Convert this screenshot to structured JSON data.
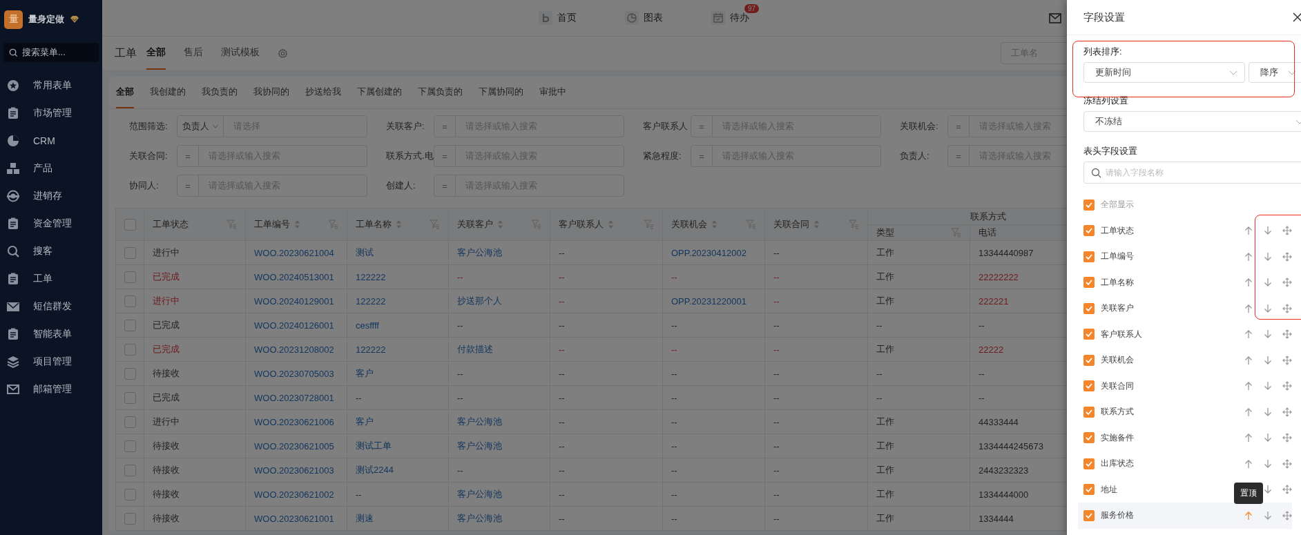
{
  "sidebar": {
    "logo": "量",
    "brand": "量身定做",
    "search_placeholder": "搜索菜单...",
    "items": [
      {
        "label": "常用表单"
      },
      {
        "label": "市场管理"
      },
      {
        "label": "CRM"
      },
      {
        "label": "产品"
      },
      {
        "label": "进销存"
      },
      {
        "label": "资金管理"
      },
      {
        "label": "搜客"
      },
      {
        "label": "工单"
      },
      {
        "label": "短信群发"
      },
      {
        "label": "智能表单"
      },
      {
        "label": "项目管理"
      },
      {
        "label": "邮箱管理"
      }
    ]
  },
  "top_nav": {
    "items": [
      {
        "label": "首页"
      },
      {
        "label": "图表"
      },
      {
        "label": "待办",
        "badge": "97"
      }
    ]
  },
  "module_tabs": {
    "title": "工单",
    "search_placeholder": "工单名",
    "tabs": [
      {
        "label": "全部",
        "selected": true
      },
      {
        "label": "售后",
        "selected": false
      },
      {
        "label": "测试模板",
        "selected": false
      }
    ]
  },
  "view_tabs": [
    {
      "label": "全部",
      "selected": true
    },
    {
      "label": "我创建的",
      "selected": false
    },
    {
      "label": "我负责的",
      "selected": false
    },
    {
      "label": "我协同的",
      "selected": false
    },
    {
      "label": "抄送给我",
      "selected": false
    },
    {
      "label": "下属创建的",
      "selected": false
    },
    {
      "label": "下属负责的",
      "selected": false
    },
    {
      "label": "下属协同的",
      "selected": false
    },
    {
      "label": "审批中",
      "selected": false
    }
  ],
  "filters": [
    {
      "label": "范围筛选:",
      "kind": "dropdown",
      "operator": "负责人",
      "placeholder": "请选择"
    },
    {
      "label": "关联客户:",
      "kind": "equals",
      "operator": "=",
      "placeholder": "请选择或输入搜索"
    },
    {
      "label": "客户联系人",
      "kind": "equals",
      "operator": "=",
      "placeholder": "请选择或输入搜索"
    },
    {
      "label": "关联机会:",
      "kind": "equals",
      "operator": "=",
      "placeholder": "请选择或输入搜索"
    },
    {
      "label": "关联合同:",
      "kind": "equals",
      "operator": "=",
      "placeholder": "请选择或输入搜索"
    },
    {
      "label": "联系方式.电",
      "kind": "equals",
      "operator": "=",
      "placeholder": "请选择或输入搜索"
    },
    {
      "label": "紧急程度:",
      "kind": "equals",
      "operator": "=",
      "placeholder": "请选择或输入搜索"
    },
    {
      "label": "负责人:",
      "kind": "equals",
      "operator": "=",
      "placeholder": "请选择或输入搜索"
    },
    {
      "label": "协同人:",
      "kind": "equals",
      "operator": "=",
      "placeholder": "请选择或输入搜索"
    },
    {
      "label": "创建人:",
      "kind": "equals",
      "operator": "=",
      "placeholder": "请选择或输入搜索"
    }
  ],
  "table": {
    "all_checked": false,
    "header_group": "联系方式",
    "columns": [
      {
        "label": "工单状态",
        "sortable": false,
        "filterable": true,
        "grouped": false
      },
      {
        "label": "工单编号",
        "sortable": true,
        "filterable": true,
        "grouped": false
      },
      {
        "label": "工单名称",
        "sortable": true,
        "filterable": true,
        "grouped": false
      },
      {
        "label": "关联客户",
        "sortable": true,
        "filterable": true,
        "grouped": false
      },
      {
        "label": "客户联系人",
        "sortable": true,
        "filterable": true,
        "grouped": false
      },
      {
        "label": "关联机会",
        "sortable": true,
        "filterable": true,
        "grouped": false
      },
      {
        "label": "关联合同",
        "sortable": true,
        "filterable": true,
        "grouped": false
      },
      {
        "label": "类型",
        "sortable": false,
        "filterable": true,
        "grouped": true
      },
      {
        "label": "电话",
        "sortable": false,
        "filterable": false,
        "grouped": true
      }
    ],
    "rows": [
      {
        "checked": false,
        "cells": [
          {
            "text": "进行中",
            "kind": "text"
          },
          {
            "text": "WOO.20230621004",
            "kind": "link"
          },
          {
            "text": "测试",
            "kind": "link"
          },
          {
            "text": "客户公海池",
            "kind": "link"
          },
          {
            "text": "--",
            "kind": "text"
          },
          {
            "text": "OPP.20230412002",
            "kind": "link"
          },
          {
            "text": "--",
            "kind": "text"
          },
          {
            "text": "工作",
            "kind": "text"
          },
          {
            "text": "13344440987",
            "kind": "text"
          }
        ]
      },
      {
        "checked": false,
        "cells": [
          {
            "text": "已完成",
            "kind": "alert"
          },
          {
            "text": "WOO.20240513001",
            "kind": "link"
          },
          {
            "text": "122222",
            "kind": "link"
          },
          {
            "text": "--",
            "kind": "alert"
          },
          {
            "text": "--",
            "kind": "alert"
          },
          {
            "text": "--",
            "kind": "alert"
          },
          {
            "text": "--",
            "kind": "alert"
          },
          {
            "text": "工作",
            "kind": "text"
          },
          {
            "text": "22222222",
            "kind": "alert"
          }
        ]
      },
      {
        "checked": false,
        "cells": [
          {
            "text": "进行中",
            "kind": "alert"
          },
          {
            "text": "WOO.20240129001",
            "kind": "link"
          },
          {
            "text": "122222",
            "kind": "link"
          },
          {
            "text": "抄送那个人",
            "kind": "link"
          },
          {
            "text": "--",
            "kind": "alert"
          },
          {
            "text": "OPP.20231220001",
            "kind": "link"
          },
          {
            "text": "--",
            "kind": "alert"
          },
          {
            "text": "工作",
            "kind": "text"
          },
          {
            "text": "222221",
            "kind": "alert"
          }
        ]
      },
      {
        "checked": false,
        "cells": [
          {
            "text": "已完成",
            "kind": "text"
          },
          {
            "text": "WOO.20240126001",
            "kind": "link"
          },
          {
            "text": "cesffff",
            "kind": "link"
          },
          {
            "text": "--",
            "kind": "text"
          },
          {
            "text": "--",
            "kind": "text"
          },
          {
            "text": "--",
            "kind": "text"
          },
          {
            "text": "--",
            "kind": "text"
          },
          {
            "text": "--",
            "kind": "text"
          },
          {
            "text": "--",
            "kind": "text"
          }
        ]
      },
      {
        "checked": false,
        "cells": [
          {
            "text": "已完成",
            "kind": "alert"
          },
          {
            "text": "WOO.20231208002",
            "kind": "link"
          },
          {
            "text": "122222",
            "kind": "link"
          },
          {
            "text": "付款描述",
            "kind": "link"
          },
          {
            "text": "--",
            "kind": "alert"
          },
          {
            "text": "--",
            "kind": "alert"
          },
          {
            "text": "--",
            "kind": "alert"
          },
          {
            "text": "工作",
            "kind": "text"
          },
          {
            "text": "22222",
            "kind": "alert"
          }
        ]
      },
      {
        "checked": false,
        "cells": [
          {
            "text": "待接收",
            "kind": "text"
          },
          {
            "text": "WOO.20230705003",
            "kind": "link"
          },
          {
            "text": "客户",
            "kind": "link"
          },
          {
            "text": "--",
            "kind": "text"
          },
          {
            "text": "--",
            "kind": "text"
          },
          {
            "text": "--",
            "kind": "text"
          },
          {
            "text": "--",
            "kind": "text"
          },
          {
            "text": "--",
            "kind": "text"
          },
          {
            "text": "--",
            "kind": "text"
          }
        ]
      },
      {
        "checked": false,
        "cells": [
          {
            "text": "已完成",
            "kind": "text"
          },
          {
            "text": "WOO.20230728001",
            "kind": "link"
          },
          {
            "text": "--",
            "kind": "text"
          },
          {
            "text": "--",
            "kind": "text"
          },
          {
            "text": "--",
            "kind": "text"
          },
          {
            "text": "--",
            "kind": "text"
          },
          {
            "text": "--",
            "kind": "text"
          },
          {
            "text": "--",
            "kind": "text"
          },
          {
            "text": "--",
            "kind": "text"
          }
        ]
      },
      {
        "checked": false,
        "cells": [
          {
            "text": "进行中",
            "kind": "text"
          },
          {
            "text": "WOO.20230621006",
            "kind": "link"
          },
          {
            "text": "客户",
            "kind": "link"
          },
          {
            "text": "客户公海池",
            "kind": "link"
          },
          {
            "text": "--",
            "kind": "text"
          },
          {
            "text": "--",
            "kind": "text"
          },
          {
            "text": "--",
            "kind": "text"
          },
          {
            "text": "工作",
            "kind": "text"
          },
          {
            "text": "44333444",
            "kind": "text"
          }
        ]
      },
      {
        "checked": false,
        "cells": [
          {
            "text": "待接收",
            "kind": "text"
          },
          {
            "text": "WOO.20230621005",
            "kind": "link"
          },
          {
            "text": "测试工单",
            "kind": "link"
          },
          {
            "text": "客户公海池",
            "kind": "link"
          },
          {
            "text": "--",
            "kind": "text"
          },
          {
            "text": "--",
            "kind": "text"
          },
          {
            "text": "--",
            "kind": "text"
          },
          {
            "text": "工作",
            "kind": "text"
          },
          {
            "text": "1334444245673",
            "kind": "text"
          }
        ]
      },
      {
        "checked": false,
        "cells": [
          {
            "text": "待接收",
            "kind": "text"
          },
          {
            "text": "WOO.20230621003",
            "kind": "link"
          },
          {
            "text": "测试2244",
            "kind": "link"
          },
          {
            "text": "--",
            "kind": "text"
          },
          {
            "text": "--",
            "kind": "text"
          },
          {
            "text": "--",
            "kind": "text"
          },
          {
            "text": "--",
            "kind": "text"
          },
          {
            "text": "工作",
            "kind": "text"
          },
          {
            "text": "2443232323",
            "kind": "text"
          }
        ]
      },
      {
        "checked": false,
        "cells": [
          {
            "text": "待接收",
            "kind": "text"
          },
          {
            "text": "WOO.20230621002",
            "kind": "link"
          },
          {
            "text": "--",
            "kind": "text"
          },
          {
            "text": "客户公海池",
            "kind": "link"
          },
          {
            "text": "--",
            "kind": "text"
          },
          {
            "text": "--",
            "kind": "text"
          },
          {
            "text": "--",
            "kind": "text"
          },
          {
            "text": "工作",
            "kind": "text"
          },
          {
            "text": "1334444000",
            "kind": "text"
          }
        ]
      },
      {
        "checked": false,
        "cells": [
          {
            "text": "待接收",
            "kind": "text"
          },
          {
            "text": "WOO.20230621001",
            "kind": "link"
          },
          {
            "text": "测速",
            "kind": "link"
          },
          {
            "text": "客户公海池",
            "kind": "link"
          },
          {
            "text": "--",
            "kind": "text"
          },
          {
            "text": "--",
            "kind": "text"
          },
          {
            "text": "--",
            "kind": "text"
          },
          {
            "text": "工作",
            "kind": "text"
          },
          {
            "text": "1334444",
            "kind": "text"
          }
        ]
      }
    ]
  },
  "drawer": {
    "title": "字段设置",
    "sort_label": "列表排序:",
    "sort_field": "更新时间",
    "sort_order": "降序",
    "freeze_label": "冻结列设置",
    "freeze_value": "不冻结",
    "fields_label": "表头字段设置",
    "search_placeholder": "请输入字段名称",
    "tooltip": "置顶",
    "show_all": {
      "label": "全部显示",
      "checked": true
    },
    "fields": [
      {
        "label": "工单状态",
        "checked": true,
        "hovered": false
      },
      {
        "label": "工单编号",
        "checked": true,
        "hovered": false
      },
      {
        "label": "工单名称",
        "checked": true,
        "hovered": false
      },
      {
        "label": "关联客户",
        "checked": true,
        "hovered": false
      },
      {
        "label": "客户联系人",
        "checked": true,
        "hovered": false
      },
      {
        "label": "关联机会",
        "checked": true,
        "hovered": false
      },
      {
        "label": "关联合同",
        "checked": true,
        "hovered": false
      },
      {
        "label": "联系方式",
        "checked": true,
        "hovered": false
      },
      {
        "label": "实施备件",
        "checked": true,
        "hovered": false
      },
      {
        "label": "出库状态",
        "checked": true,
        "hovered": false
      },
      {
        "label": "地址",
        "checked": true,
        "hovered": false
      },
      {
        "label": "服务价格",
        "checked": true,
        "hovered": true
      }
    ]
  }
}
